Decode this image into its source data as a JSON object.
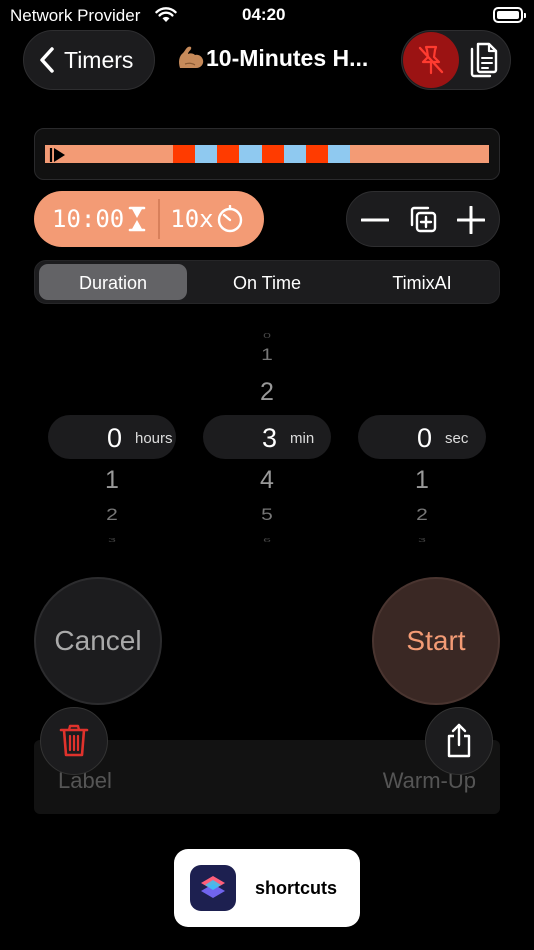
{
  "status_bar": {
    "carrier": "Network Provider",
    "time": "04:20"
  },
  "nav": {
    "back_label": "Timers",
    "title": "10-Minutes H..."
  },
  "colors": {
    "accent": "#f39b75",
    "timeline_red": "#ff3b00",
    "timeline_blue": "#8fc9f0",
    "pin_active_bg": "#9b1313",
    "pin_icon": "#ff3b30",
    "delete_icon": "#e0322c"
  },
  "timeline": {
    "segments": [
      {
        "kind": "warmup",
        "share": 0.288,
        "color": "#f39b75"
      },
      {
        "kind": "work",
        "share": 0.05,
        "color": "#ff3b00"
      },
      {
        "kind": "rest",
        "share": 0.05,
        "color": "#8fc9f0"
      },
      {
        "kind": "work",
        "share": 0.05,
        "color": "#ff3b00"
      },
      {
        "kind": "rest",
        "share": 0.05,
        "color": "#8fc9f0"
      },
      {
        "kind": "work",
        "share": 0.05,
        "color": "#ff3b00"
      },
      {
        "kind": "rest",
        "share": 0.05,
        "color": "#8fc9f0"
      },
      {
        "kind": "work",
        "share": 0.05,
        "color": "#ff3b00"
      },
      {
        "kind": "rest",
        "share": 0.05,
        "color": "#8fc9f0"
      },
      {
        "kind": "cooldown",
        "share": 0.312,
        "color": "#f39b75"
      }
    ]
  },
  "summary": {
    "duration": "10:00",
    "rounds": "10x"
  },
  "tabs": [
    {
      "label": "Duration",
      "selected": true
    },
    {
      "label": "On Time",
      "selected": false
    },
    {
      "label": "TimixAI",
      "selected": false
    }
  ],
  "picker": {
    "hours": {
      "value": "0",
      "unit": "hours",
      "above": [],
      "below": [
        "1",
        "2",
        "3"
      ]
    },
    "minutes": {
      "value": "3",
      "unit": "min",
      "above": [
        "0",
        "1",
        "2"
      ],
      "below": [
        "4",
        "5",
        "6"
      ]
    },
    "seconds": {
      "value": "0",
      "unit": "sec",
      "above": [],
      "below": [
        "1",
        "2",
        "3"
      ]
    }
  },
  "actions": {
    "cancel": "Cancel",
    "start": "Start"
  },
  "interval": {
    "label": "Label",
    "type": "Warm-Up"
  },
  "banner": {
    "label": "shortcuts"
  }
}
